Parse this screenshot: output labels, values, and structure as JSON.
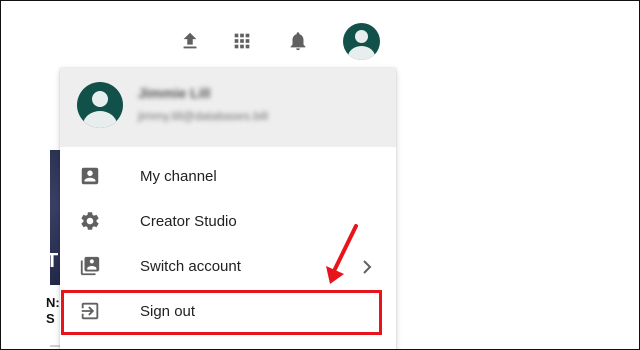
{
  "topbar": {
    "icons": [
      "upload-icon",
      "apps-icon",
      "notifications-bell-icon"
    ],
    "icon_color": "#606060",
    "avatar_color": "#11514a"
  },
  "background_page": {
    "thumb_text": "TR",
    "title_fragment_1": "N:",
    "title_fragment_2": "S"
  },
  "account_menu": {
    "user_name": "Jimmie Lill",
    "user_email": "jimmy.lill@databases.bill",
    "items": [
      {
        "label": "My channel",
        "icon": "account-box-icon"
      },
      {
        "label": "Creator Studio",
        "icon": "gear-icon"
      },
      {
        "label": "Switch account",
        "icon": "switch-account-icon",
        "has_submenu": true
      },
      {
        "label": "Sign out",
        "icon": "sign-out-icon"
      }
    ]
  },
  "annotation": {
    "highlight_color": "#e8141c"
  }
}
